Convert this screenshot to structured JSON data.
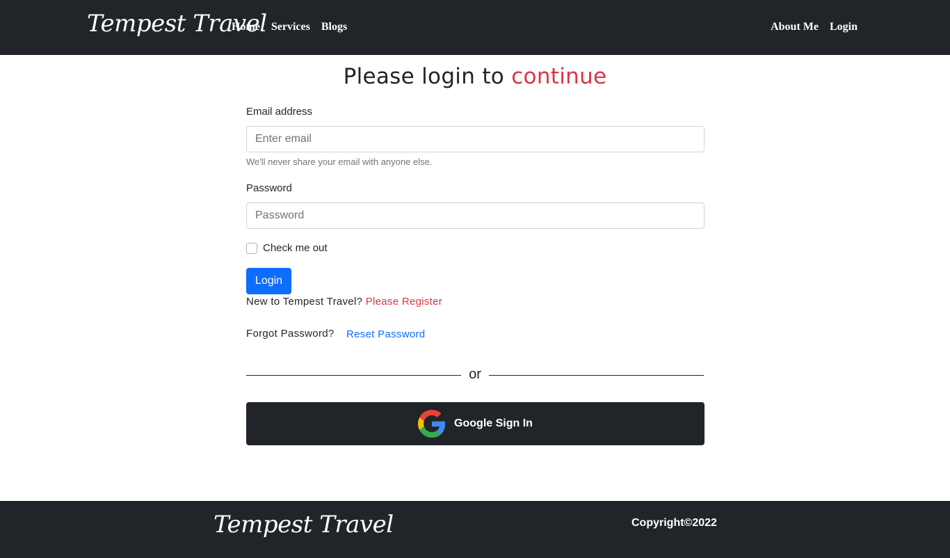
{
  "navbar": {
    "brand": "Tempest Travel",
    "left_links": [
      "Home",
      "Services",
      "Blogs"
    ],
    "right_links": [
      "About Me",
      "Login"
    ]
  },
  "main": {
    "title_prefix": "Please login to",
    "title_accent": "continue",
    "email": {
      "label": "Email address",
      "placeholder": "Enter email",
      "value": "",
      "help": "We'll never share your email with anyone else."
    },
    "password": {
      "label": "Password",
      "placeholder": "Password",
      "value": ""
    },
    "checkbox_label": "Check me out",
    "login_button": "Login",
    "register_prompt": "New to Tempest Travel?",
    "register_link": "Please Register",
    "forgot_prompt": "Forgot Password?",
    "reset_link": "Reset Password",
    "divider_text": "or",
    "google_button": "Google Sign In"
  },
  "footer": {
    "brand": "Tempest Travel",
    "copyright": "Copyright©2022"
  },
  "colors": {
    "dark": "#212529",
    "accent_red": "#dc3545",
    "primary_blue": "#0d6efd"
  }
}
